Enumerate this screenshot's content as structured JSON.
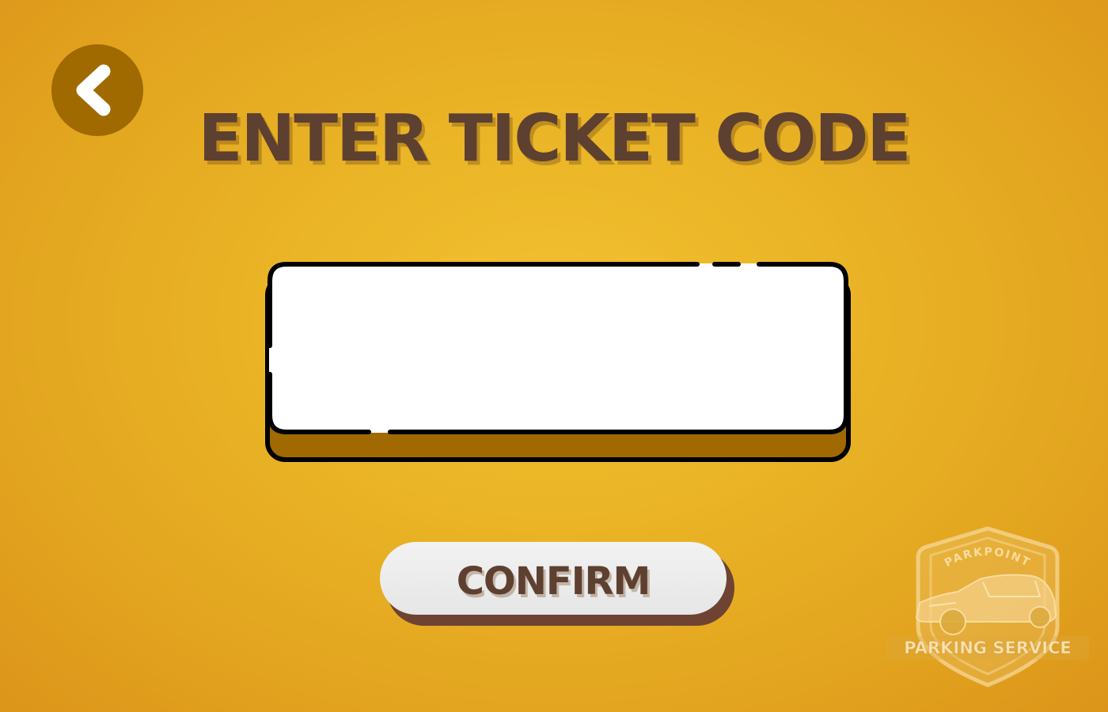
{
  "back_button": {
    "icon": "chevron-left-icon"
  },
  "title": "ENTER TICKET CODE",
  "ticket_input": {
    "value": "",
    "placeholder": ""
  },
  "confirm_button": {
    "label": "CONFIRM"
  },
  "logo": {
    "top_text": "PARKPOINT",
    "bottom_text": "PARKING SERVICE"
  },
  "colors": {
    "background": "#eab526",
    "title": "#5e4030",
    "back_button": "#a06a00",
    "input_shadow": "#a06a00",
    "button_face": "#eeeeee"
  }
}
